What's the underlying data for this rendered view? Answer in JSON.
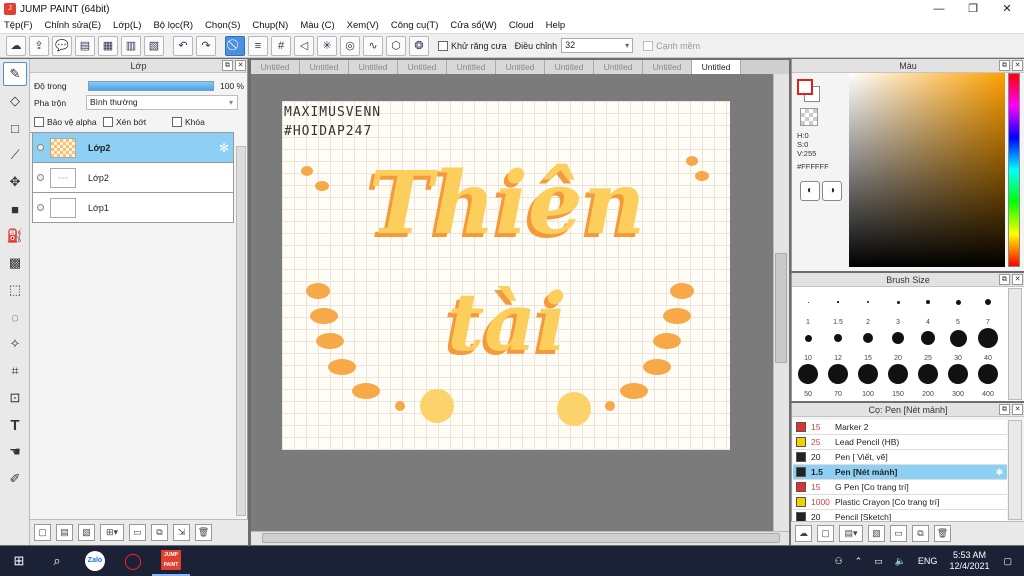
{
  "window": {
    "title": "JUMP PAINT (64bit)",
    "min": "—",
    "restore": "❐",
    "close": "✕"
  },
  "menu": [
    "Tệp(F)",
    "Chỉnh sửa(E)",
    "Lớp(L)",
    "Bộ lọc(R)",
    "Chọn(S)",
    "Chụp(N)",
    "Màu (C)",
    "Xem(V)",
    "Công cụ(T)",
    "Cửa sổ(W)",
    "Cloud",
    "Help"
  ],
  "toolbar": {
    "antialias_label": "Khử răng cưa",
    "adjust_label": "Điều chỉnh",
    "adjust_value": "32",
    "smooth_edge_label": "Cạnh mềm"
  },
  "layer_panel": {
    "title": "Lớp",
    "opacity_label": "Độ trong",
    "opacity_value": "100 %",
    "blend_label": "Pha trộn",
    "blend_value": "Bình thường",
    "protect_alpha": "Bảo vệ alpha",
    "clipping": "Xén bớt",
    "lock": "Khóa",
    "layers": [
      {
        "name": "Lớp2",
        "selected": true
      },
      {
        "name": "Lớp2",
        "selected": false
      },
      {
        "name": "Lớp1",
        "selected": false
      }
    ]
  },
  "tabs": [
    "Untitled",
    "Untitled",
    "Untitled",
    "Untitled",
    "Untitled",
    "Untitled",
    "Untitled",
    "Untitled",
    "Untitled",
    "Untitled"
  ],
  "artwork": {
    "signature_line1": "MAXIMUSVENN",
    "signature_line2": "#HOIDAP247",
    "word1": "Thiên",
    "word2": "tài"
  },
  "color_panel": {
    "title": "Màu",
    "h": "H:0",
    "s": "S:0",
    "v": "V:255",
    "hex": "#FFFFFF"
  },
  "brush_size": {
    "title": "Brush Size",
    "sizes": [
      "1",
      "1.5",
      "2",
      "3",
      "4",
      "5",
      "7",
      "10",
      "12",
      "15",
      "20",
      "25",
      "30",
      "40",
      "50",
      "70",
      "100",
      "150",
      "200",
      "300",
      "400"
    ]
  },
  "presets": {
    "title": "Cọ: Pen [Nét mảnh]",
    "items": [
      {
        "size": "15",
        "name": "Marker 2",
        "color": "#e03030"
      },
      {
        "size": "25",
        "name": "Lead Pencil (HB)",
        "color": "#f0d000"
      },
      {
        "size": "20",
        "name": "Pen [ Viết, vẽ]",
        "color": "#222222"
      },
      {
        "size": "1.5",
        "name": "Pen [Nét mảnh]",
        "color": "#222222"
      },
      {
        "size": "15",
        "name": "G Pen [Co trang trí]",
        "color": "#e03030"
      },
      {
        "size": "1000",
        "name": "Plastic Crayon [Co trang trí]",
        "color": "#f0d000"
      },
      {
        "size": "20",
        "name": "Pencil [Sketch]",
        "color": "#222222"
      }
    ]
  },
  "taskbar": {
    "lang": "ENG",
    "time": "5:53 AM",
    "date": "12/4/2021",
    "zalo": "Zalo",
    "jump": "JUMP PAINT"
  }
}
